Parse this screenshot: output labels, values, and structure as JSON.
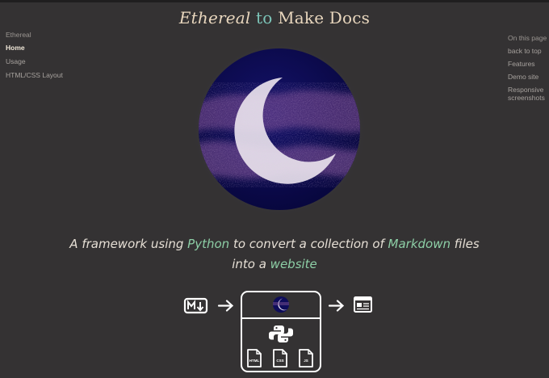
{
  "title": {
    "prefix": "Ethereal",
    "middle": " to ",
    "suffix": "Make Docs"
  },
  "left_nav": {
    "heading": "Ethereal",
    "items": [
      {
        "label": "Home",
        "active": true
      },
      {
        "label": "Usage",
        "active": false
      },
      {
        "label": "HTML/CSS Layout",
        "active": false
      }
    ]
  },
  "toc": {
    "heading": "On this page",
    "items": [
      "back to top",
      "Features",
      "Demo site",
      "Responsive screenshots"
    ]
  },
  "tagline": {
    "p1": "A framework using ",
    "w1": "Python",
    "p2": " to convert a collection of ",
    "w2": "Markdown",
    "p3": " files",
    "p4": "into a ",
    "w3": "website"
  },
  "diagram": {
    "file_labels": [
      "HTML",
      "CSS",
      "JS"
    ],
    "icons": [
      "markdown-icon",
      "arrow-right-icon",
      "ethereal-logo-icon",
      "python-icon",
      "html-file-icon",
      "css-file-icon",
      "js-file-icon",
      "website-icon"
    ]
  },
  "colors": {
    "background": "#343233",
    "title": "#e9d7be",
    "accent_teal": "#7cc4b8",
    "accent_green": "#8dcfa6",
    "hero_navy": "#0c0b55",
    "hero_purple": "#8a5a9a"
  }
}
